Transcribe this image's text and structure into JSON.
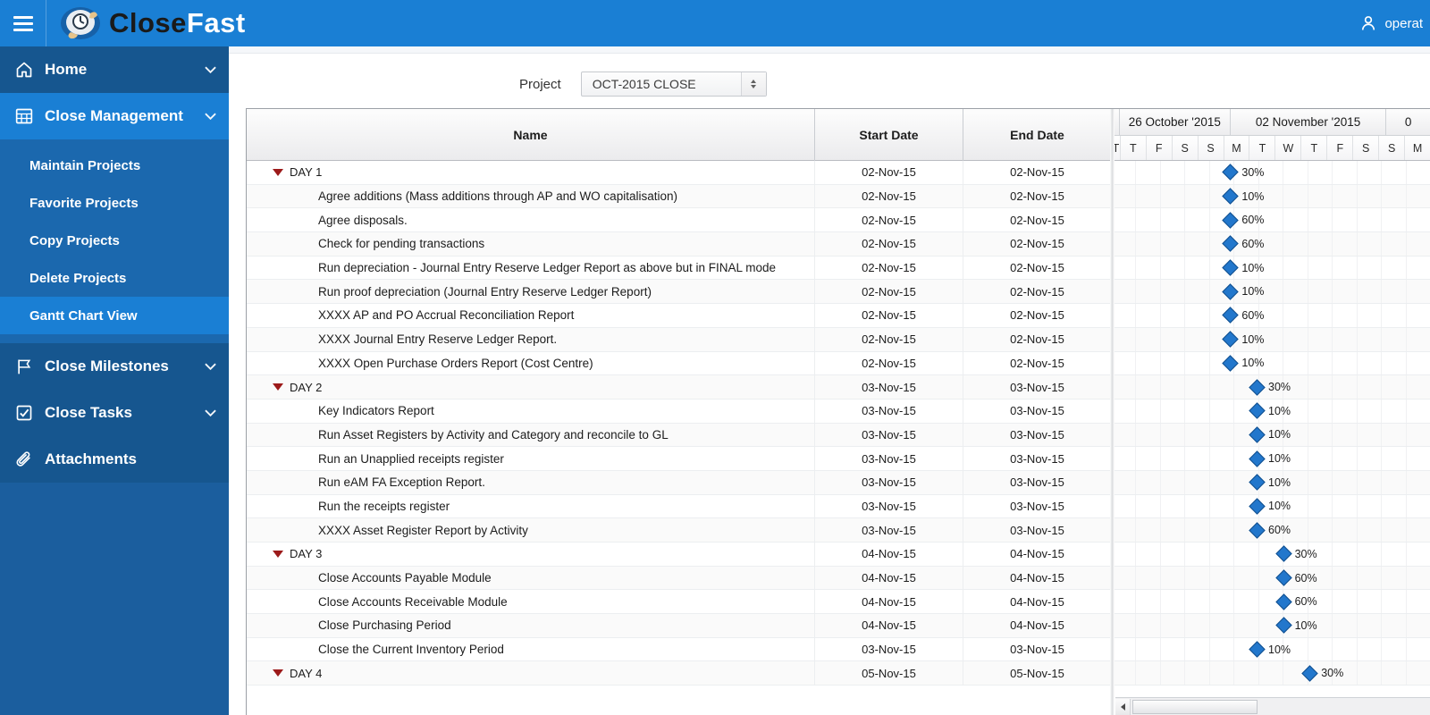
{
  "app": {
    "brand_close": "Close",
    "brand_fast": "Fast",
    "menu_icon": "hamburger-icon",
    "user_icon": "user-icon",
    "user_label": "operat"
  },
  "sidebar": {
    "groups": [
      {
        "label": "Home",
        "icon": "home-icon",
        "state": "collapsed"
      },
      {
        "label": "Close Management",
        "icon": "grid-icon",
        "state": "expanded"
      },
      {
        "label": "Close Milestones",
        "icon": "flag-icon",
        "state": "collapsed"
      },
      {
        "label": "Close Tasks",
        "icon": "checkbox-icon",
        "state": "collapsed"
      },
      {
        "label": "Attachments",
        "icon": "paperclip-icon",
        "state": "none"
      }
    ],
    "close_management_items": [
      {
        "label": "Maintain Projects",
        "selected": false
      },
      {
        "label": "Favorite Projects",
        "selected": false
      },
      {
        "label": "Copy Projects",
        "selected": false
      },
      {
        "label": "Delete Projects",
        "selected": false
      },
      {
        "label": "Gantt Chart View",
        "selected": true
      }
    ]
  },
  "project_bar": {
    "label": "Project",
    "selected_value": "OCT-2015 CLOSE"
  },
  "grid": {
    "columns": [
      "Name",
      "Start Date",
      "End Date"
    ]
  },
  "timeline": {
    "months": [
      {
        "label": "26 October '2015",
        "days": 5
      },
      {
        "label": "02 November '2015",
        "days": 7
      },
      {
        "label": "0",
        "days": 2
      }
    ],
    "day_letters": [
      "T",
      "F",
      "S",
      "S",
      "M",
      "T",
      "W",
      "T",
      "F",
      "S",
      "S",
      "M"
    ],
    "partial_first_letter": "T"
  },
  "chart_data": {
    "type": "table",
    "title": "OCT-2015 CLOSE — Gantt Chart View",
    "rows": [
      {
        "name": "DAY 1",
        "type": "summary",
        "start": "02-Nov-15",
        "end": "02-Nov-15",
        "pct": "30%",
        "col": 4
      },
      {
        "name": "Agree additions (Mass additions through AP and WO capitalisation)",
        "type": "task",
        "start": "02-Nov-15",
        "end": "02-Nov-15",
        "pct": "10%",
        "col": 4
      },
      {
        "name": "Agree disposals.",
        "type": "task",
        "start": "02-Nov-15",
        "end": "02-Nov-15",
        "pct": "60%",
        "col": 4
      },
      {
        "name": "Check for pending transactions",
        "type": "task",
        "start": "02-Nov-15",
        "end": "02-Nov-15",
        "pct": "60%",
        "col": 4
      },
      {
        "name": "Run  depreciation - Journal Entry Reserve Ledger Report as above but in FINAL mode",
        "type": "task",
        "start": "02-Nov-15",
        "end": "02-Nov-15",
        "pct": "10%",
        "col": 4
      },
      {
        "name": "Run proof depreciation (Journal Entry Reserve Ledger Report)",
        "type": "task",
        "start": "02-Nov-15",
        "end": "02-Nov-15",
        "pct": "10%",
        "col": 4
      },
      {
        "name": "XXXX AP and PO Accrual Reconciliation Report",
        "type": "task",
        "start": "02-Nov-15",
        "end": "02-Nov-15",
        "pct": "60%",
        "col": 4
      },
      {
        "name": "XXXX Journal Entry Reserve Ledger Report.",
        "type": "task",
        "start": "02-Nov-15",
        "end": "02-Nov-15",
        "pct": "10%",
        "col": 4
      },
      {
        "name": "XXXX Open Purchase Orders Report (Cost Centre)",
        "type": "task",
        "start": "02-Nov-15",
        "end": "02-Nov-15",
        "pct": "10%",
        "col": 4
      },
      {
        "name": "DAY 2",
        "type": "summary",
        "start": "03-Nov-15",
        "end": "03-Nov-15",
        "pct": "30%",
        "col": 5
      },
      {
        "name": "Key Indicators Report",
        "type": "task",
        "start": "03-Nov-15",
        "end": "03-Nov-15",
        "pct": "10%",
        "col": 5
      },
      {
        "name": "Run Asset Registers by Activity and Category and reconcile to GL",
        "type": "task",
        "start": "03-Nov-15",
        "end": "03-Nov-15",
        "pct": "10%",
        "col": 5
      },
      {
        "name": "Run an Unapplied receipts register",
        "type": "task",
        "start": "03-Nov-15",
        "end": "03-Nov-15",
        "pct": "10%",
        "col": 5
      },
      {
        "name": "Run eAM FA Exception Report.",
        "type": "task",
        "start": "03-Nov-15",
        "end": "03-Nov-15",
        "pct": "10%",
        "col": 5
      },
      {
        "name": "Run the receipts register",
        "type": "task",
        "start": "03-Nov-15",
        "end": "03-Nov-15",
        "pct": "10%",
        "col": 5
      },
      {
        "name": "XXXX Asset Register Report by Activity",
        "type": "task",
        "start": "03-Nov-15",
        "end": "03-Nov-15",
        "pct": "60%",
        "col": 5
      },
      {
        "name": "DAY 3",
        "type": "summary",
        "start": "04-Nov-15",
        "end": "04-Nov-15",
        "pct": "30%",
        "col": 6
      },
      {
        "name": "Close Accounts Payable Module",
        "type": "task",
        "start": "04-Nov-15",
        "end": "04-Nov-15",
        "pct": "60%",
        "col": 6
      },
      {
        "name": "Close Accounts Receivable Module",
        "type": "task",
        "start": "04-Nov-15",
        "end": "04-Nov-15",
        "pct": "60%",
        "col": 6
      },
      {
        "name": "Close Purchasing Period",
        "type": "task",
        "start": "04-Nov-15",
        "end": "04-Nov-15",
        "pct": "10%",
        "col": 6
      },
      {
        "name": "Close the Current Inventory Period",
        "type": "task",
        "start": "03-Nov-15",
        "end": "03-Nov-15",
        "pct": "10%",
        "col": 5
      },
      {
        "name": "DAY 4",
        "type": "summary",
        "start": "05-Nov-15",
        "end": "05-Nov-15",
        "pct": "30%",
        "col": 7
      }
    ]
  },
  "scrollbar": {
    "left_arrow": "scroll-left-icon"
  }
}
